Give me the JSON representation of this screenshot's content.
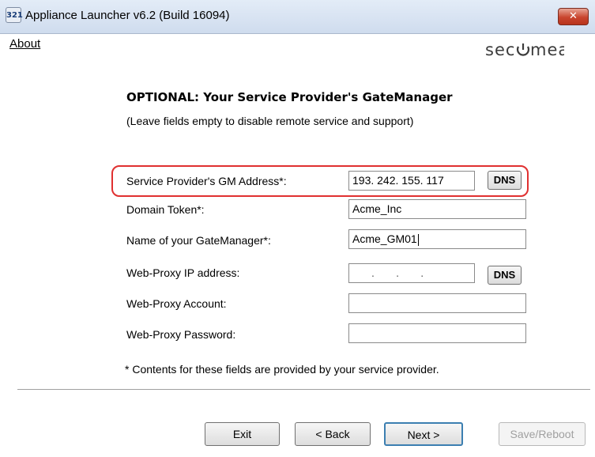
{
  "window": {
    "title": "Appliance Launcher v6.2 (Build 16094)",
    "icon_text": "321",
    "close_label": "✕"
  },
  "menu": {
    "about": "About"
  },
  "brand": {
    "logo_text": "secumea"
  },
  "page": {
    "heading": "OPTIONAL: Your Service Provider's GateManager",
    "subheading": "(Leave fields empty to disable remote service and support)"
  },
  "form": {
    "gm_address_label": "Service Provider's GM Address*:",
    "gm_address_value": "193. 242. 155. 117",
    "dns_label": "DNS",
    "domain_token_label": "Domain Token*:",
    "domain_token_value": "Acme_Inc",
    "gatemanager_name_label": "Name of your GateManager*:",
    "gatemanager_name_value": "Acme_GM01",
    "proxy_ip_label": "Web-Proxy IP address:",
    "proxy_ip_value": ".       .       .",
    "proxy_account_label": "Web-Proxy Account:",
    "proxy_account_value": "",
    "proxy_password_label": "Web-Proxy Password:",
    "proxy_password_value": ""
  },
  "note": "* Contents for these fields are provided by your service provider.",
  "buttons": {
    "exit": "Exit",
    "back": "< Back",
    "next": "Next >",
    "save_reboot": "Save/Reboot"
  },
  "colors": {
    "highlight": "#e03030",
    "titlebar": "#cfdcee",
    "close_button": "#c9452e",
    "default_button_border": "#3c7fb1"
  }
}
